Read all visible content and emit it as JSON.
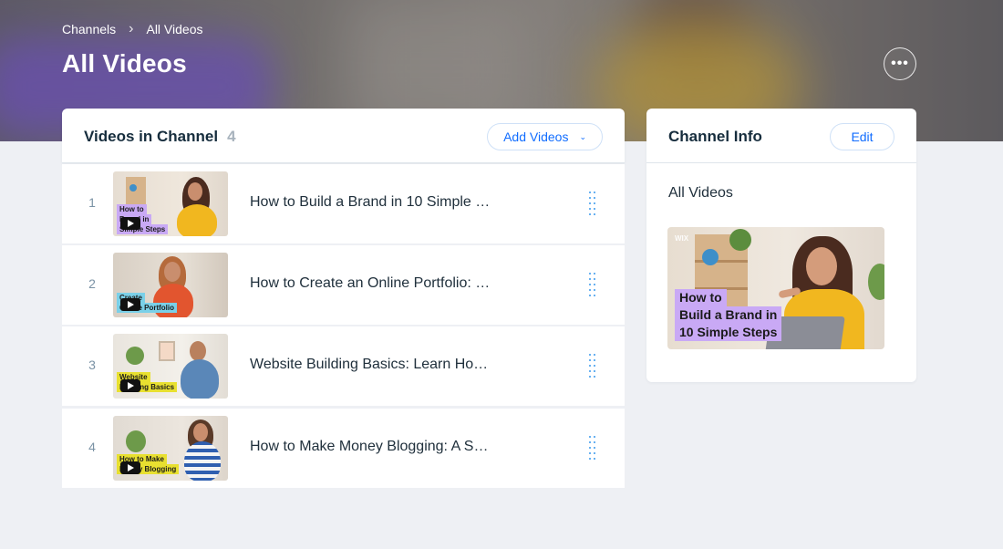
{
  "breadcrumb": {
    "root": "Channels",
    "current": "All Videos"
  },
  "page": {
    "title": "All Videos",
    "more_label": "•••"
  },
  "videos_panel": {
    "title": "Videos in Channel",
    "count": "4",
    "add_button": "Add Videos",
    "items": [
      {
        "num": "1",
        "title": "How to Build a Brand in 10 Simple …",
        "thumb_label": [
          "How to",
          "Brand in",
          "Simple Steps"
        ]
      },
      {
        "num": "2",
        "title": "How to Create an Online Portfolio: …",
        "thumb_label": [
          "Create",
          "Online Portfolio"
        ]
      },
      {
        "num": "3",
        "title": "Website Building Basics: Learn Ho…",
        "thumb_label": [
          "Website",
          "Building Basics"
        ]
      },
      {
        "num": "4",
        "title": "How to Make Money Blogging: A S…",
        "thumb_label": [
          "How to Make",
          "Money Blogging"
        ]
      }
    ]
  },
  "channel_info": {
    "title": "Channel Info",
    "edit_button": "Edit",
    "channel_name": "All Videos",
    "cover_label": [
      "How to",
      "Build a Brand in",
      "10 Simple Steps"
    ],
    "cover_watermark": "WIX"
  },
  "icons": {
    "breadcrumb_separator": "chevron-right-icon",
    "add_dropdown": "chevron-down-icon",
    "more": "more-horizontal-icon",
    "drag": "drag-handle-icon",
    "play": "play-icon"
  },
  "colors": {
    "accent": "#116dff",
    "background": "#eef0f4",
    "card": "#ffffff",
    "count": "#a8b3bd"
  }
}
